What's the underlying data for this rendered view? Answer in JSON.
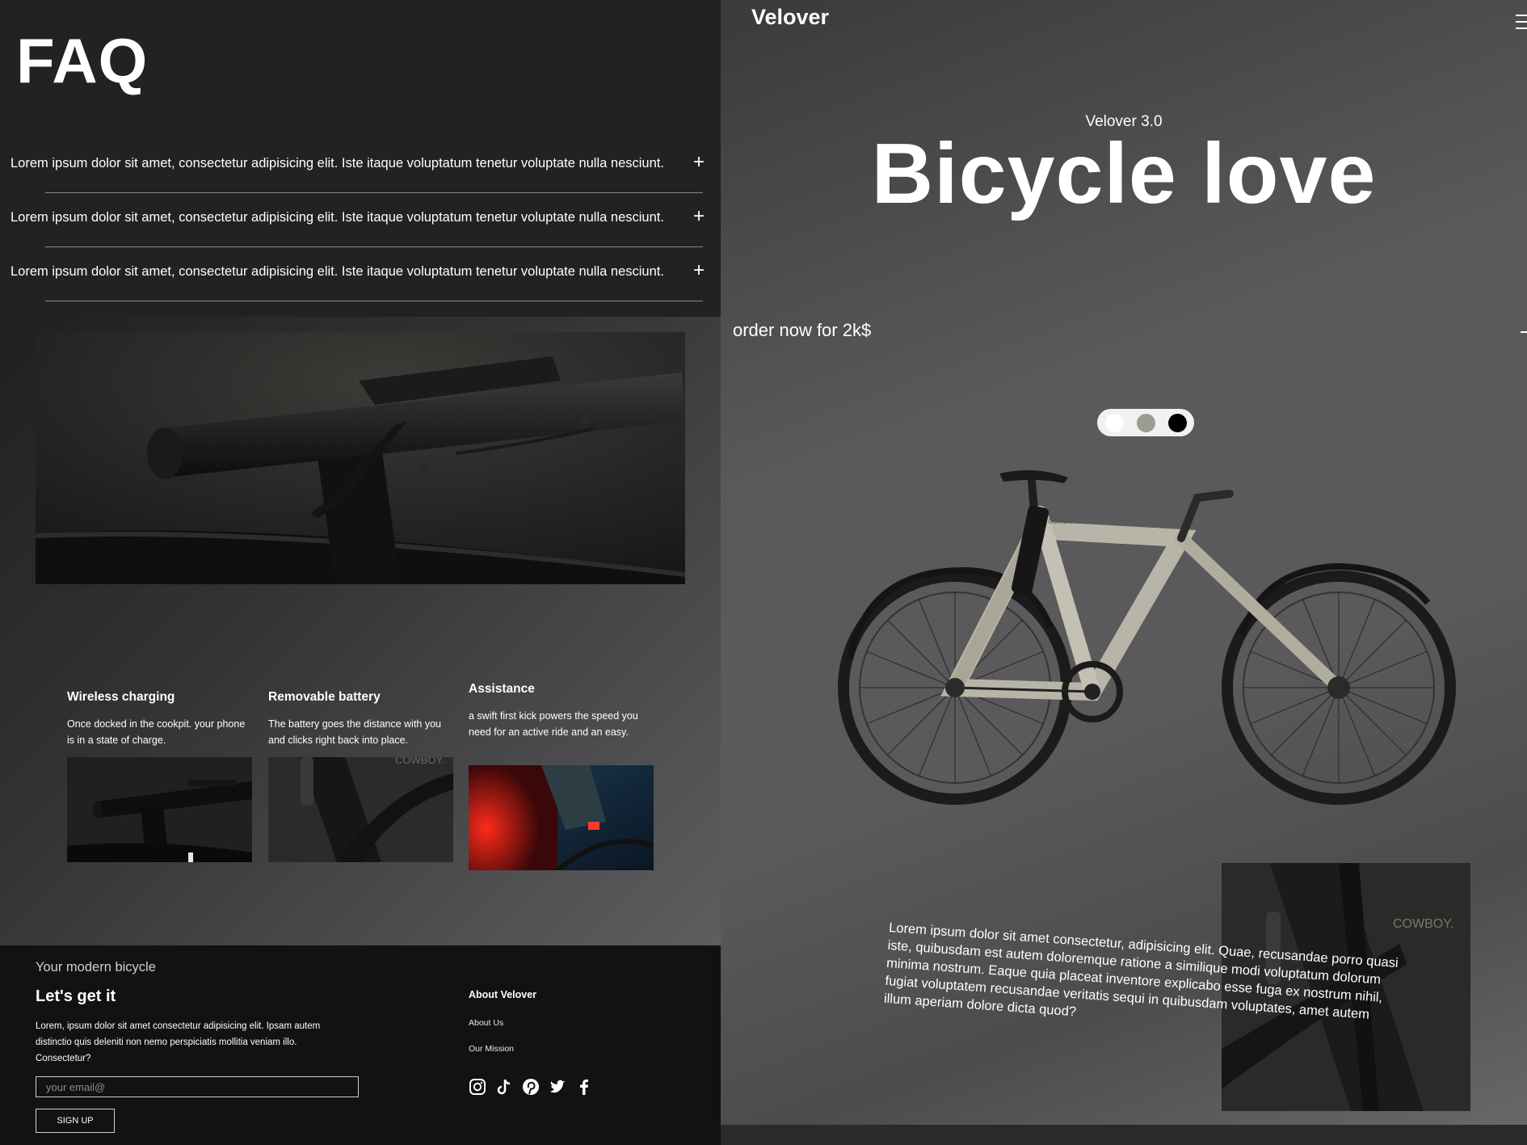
{
  "faq": {
    "title": "FAQ",
    "items": [
      {
        "question": "Lorem ipsum dolor sit amet, consectetur adipisicing elit. Iste itaque voluptatum tenetur voluptate nulla nesciunt.",
        "toggle": "+"
      },
      {
        "question": "Lorem ipsum dolor sit amet, consectetur adipisicing elit. Iste itaque voluptatum tenetur voluptate nulla nesciunt.",
        "toggle": "+"
      },
      {
        "question": "Lorem ipsum dolor sit amet, consectetur adipisicing elit. Iste itaque voluptatum tenetur voluptate nulla nesciunt.",
        "toggle": "+"
      }
    ]
  },
  "features": [
    {
      "title": "Wireless charging",
      "text": "Once docked in the cookpit. your phone is in a state of charge."
    },
    {
      "title": "Removable battery",
      "text": "The battery goes the distance with you and clicks right back into place."
    },
    {
      "title": "Assistance",
      "text": "a swift first kick powers the speed you need for an active ride and an easy."
    }
  ],
  "photo_watermarks": {
    "battery": "COWBOY.",
    "frame": "COWBOY.",
    "bike": "COWBOY."
  },
  "footer": {
    "tagline": "Your modern bicycle",
    "heading": "Let's get it",
    "text": "Lorem, ipsum dolor sit amet consectetur adipisicing elit. Ipsam autem distinctio quis deleniti non nemo perspiciatis mollitia veniam illo. Consectetur?",
    "email_placeholder": "your email@",
    "signup_label": "SIGN UP",
    "links_title": "About Velover",
    "links": [
      "About Us",
      "Our Mission"
    ],
    "social_icons": [
      "instagram-icon",
      "tiktok-icon",
      "pinterest-icon",
      "twitter-icon",
      "facebook-icon"
    ]
  },
  "hero": {
    "brand": "Velover",
    "subtitle": "Velover 3.0",
    "headline": "Bicycle love",
    "order_text": "order now for 2k$",
    "color_options": [
      "#ffffff",
      "#9a9d90",
      "#000000"
    ],
    "description": "Lorem ipsum dolor sit amet consectetur, adipisicing elit. Quae, recusandae porro quasi iste, quibusdam est autem doloremque ratione a similique modi voluptatum dolorum minima nostrum. Eaque quia placeat inventore explicabo esse fuga ex nostrum nihil, fugiat voluptatem recusandae veritatis sequi in quibusdam voluptates, amet autem illum aperiam dolore dicta quod?"
  }
}
